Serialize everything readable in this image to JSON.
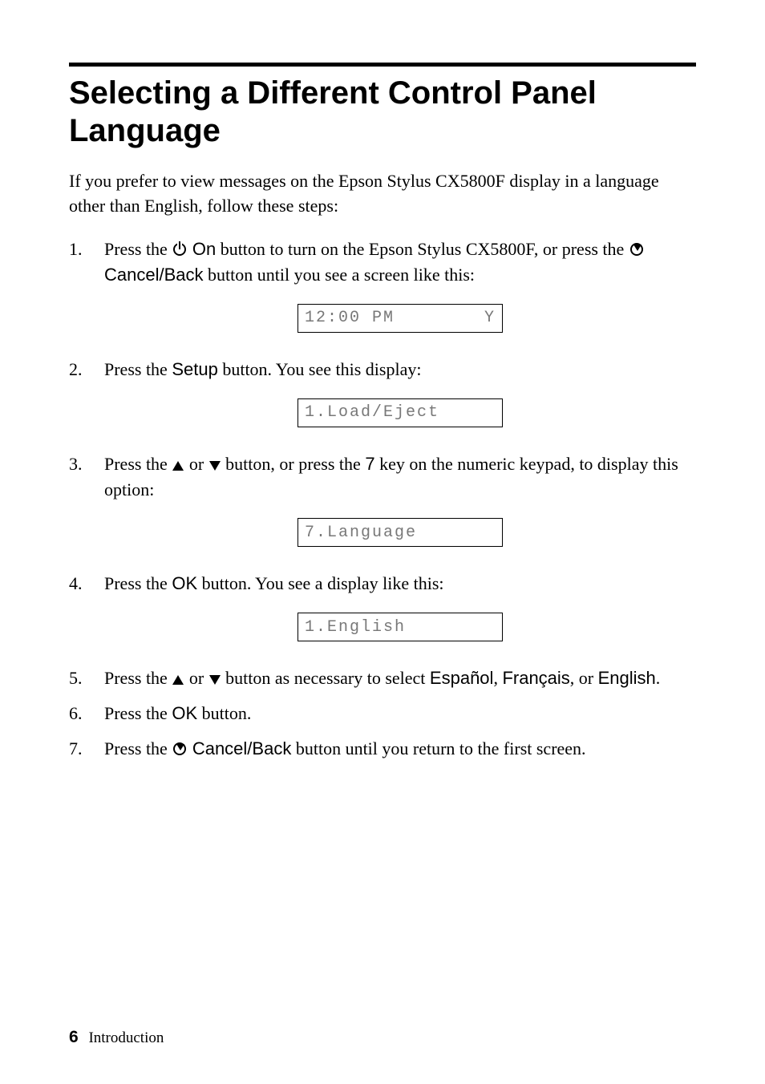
{
  "heading": "Selecting a Different Control Panel Language",
  "intro": "If you prefer to view messages on the Epson Stylus CX5800F display in a language other than English, follow these steps:",
  "steps": {
    "s1": {
      "pre": "Press the ",
      "btn_on": "On",
      "mid": " button to turn on the Epson Stylus CX5800F, or press the ",
      "btn_cancel": "Cancel/Back",
      "post": " button until you see a screen like this:"
    },
    "s2": {
      "pre": "Press the ",
      "btn_setup": "Setup",
      "post": " button. You see this display:"
    },
    "s3": {
      "pre": "Press the ",
      "or": " or ",
      "mid": " button, or press the ",
      "key7": "7",
      "post": " key on the numeric keypad, to display this option:"
    },
    "s4": {
      "pre": "Press the ",
      "btn_ok": "OK",
      "post": " button. You see a display like this:"
    },
    "s5": {
      "pre": "Press the ",
      "or": " or ",
      "mid": " button as necessary to select ",
      "opt1": "Español",
      "comma1": ", ",
      "opt2": "Français",
      "comma2": ", or ",
      "opt3": "English",
      "post": "."
    },
    "s6": {
      "pre": "Press the ",
      "btn_ok": "OK",
      "post": " button."
    },
    "s7": {
      "pre": "Press the ",
      "btn_cancel": "Cancel/Back",
      "post": " button until you return to the first screen."
    }
  },
  "lcd": {
    "l1_left": "12:00 PM",
    "l1_right": "Y",
    "l2": "1.Load/Eject",
    "l3": "7.Language",
    "l4": "1.English"
  },
  "footer": {
    "page": "6",
    "section": "Introduction"
  }
}
